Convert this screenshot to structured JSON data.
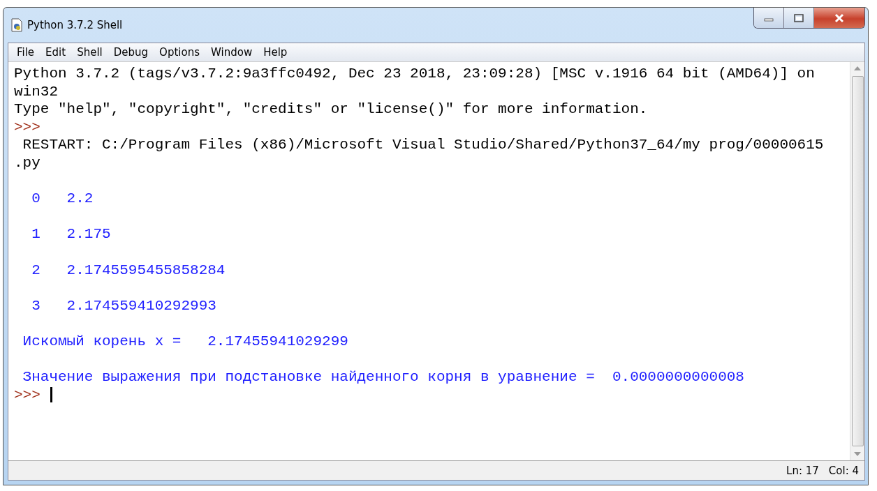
{
  "window": {
    "title": "Python 3.7.2 Shell"
  },
  "menu": [
    "File",
    "Edit",
    "Shell",
    "Debug",
    "Options",
    "Window",
    "Help"
  ],
  "shell_lines": [
    {
      "kind": "output",
      "text": "Python 3.7.2 (tags/v3.7.2:9a3ffc0492, Dec 23 2018, 23:09:28) [MSC v.1916 64 bit (AMD64)] on"
    },
    {
      "kind": "output",
      "text": "win32"
    },
    {
      "kind": "output",
      "text": "Type \"help\", \"copyright\", \"credits\" or \"license()\" for more information."
    },
    {
      "kind": "prompt",
      "text": ">>>"
    },
    {
      "kind": "output",
      "text": " RESTART: C:/Program Files (x86)/Microsoft Visual Studio/Shared/Python37_64/my prog/00000615"
    },
    {
      "kind": "output",
      "text": ".py"
    },
    {
      "kind": "blank"
    },
    {
      "kind": "stdout",
      "text": "  0   2.2"
    },
    {
      "kind": "blank"
    },
    {
      "kind": "stdout",
      "text": "  1   2.175"
    },
    {
      "kind": "blank"
    },
    {
      "kind": "stdout",
      "text": "  2   2.1745595455858284"
    },
    {
      "kind": "blank"
    },
    {
      "kind": "stdout",
      "text": "  3   2.174559410292993"
    },
    {
      "kind": "blank"
    },
    {
      "kind": "stdout",
      "text": " Искомый корень x =   2.17455941029299"
    },
    {
      "kind": "blank"
    },
    {
      "kind": "stdout",
      "text": " Значение выражения при подстановке найденного корня в уравнение =  0.0000000000008"
    },
    {
      "kind": "input",
      "text": ">>>"
    }
  ],
  "status_bar": {
    "line": "Ln: 17",
    "column": "Col: 4"
  }
}
